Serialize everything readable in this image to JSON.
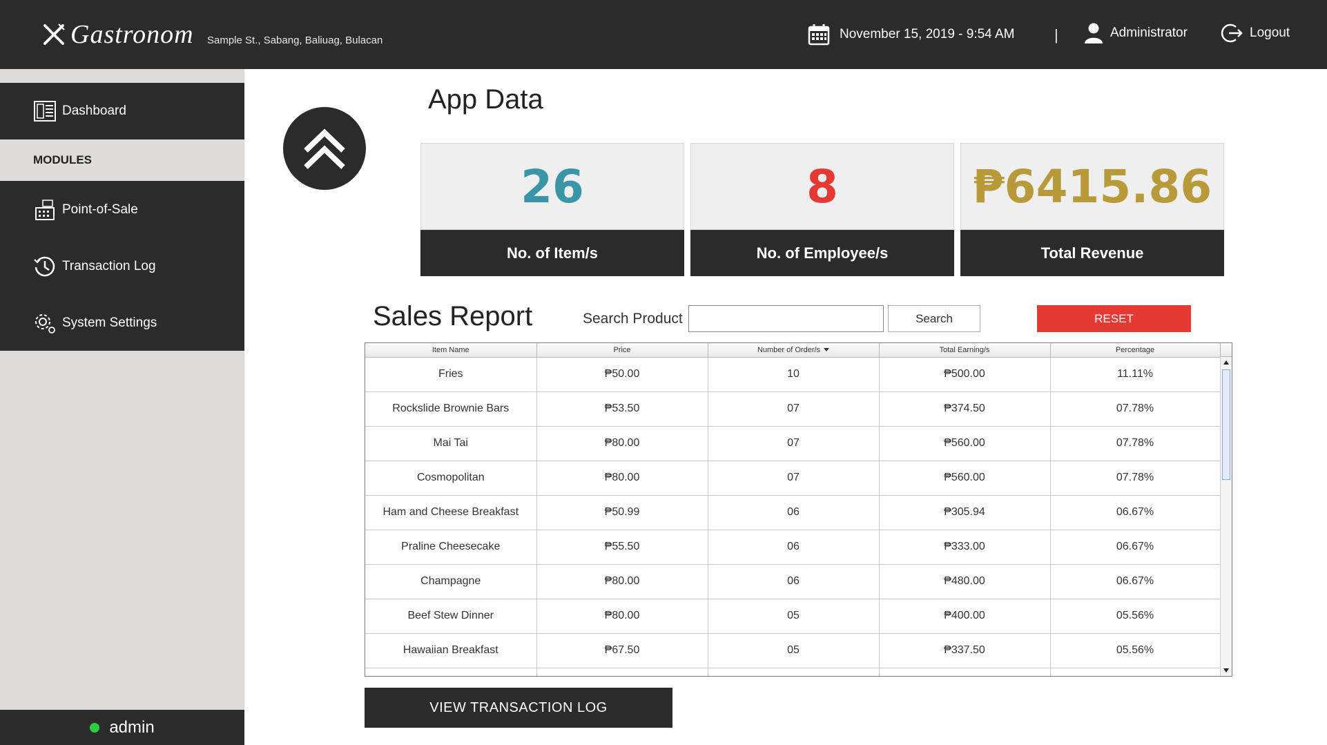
{
  "header": {
    "brand": "Gastronom",
    "address": "Sample St., Sabang, Baliuag, Bulacan",
    "datetime": "November 15, 2019 - 9:54 AM",
    "separator": "|",
    "user": "Administrator",
    "logout": "Logout"
  },
  "sidebar": {
    "dashboard": "Dashboard",
    "modules_label": "MODULES",
    "items": [
      {
        "label": "Point-of-Sale",
        "icon": "register-icon"
      },
      {
        "label": "Transaction Log",
        "icon": "clock-icon"
      },
      {
        "label": "System Settings",
        "icon": "gear-icon"
      }
    ],
    "current_user": "admin",
    "status_color": "#2ecc40"
  },
  "app_data": {
    "title": "App Data",
    "cards": [
      {
        "value": "26",
        "label": "No. of Item/s",
        "color": "#3a96a6"
      },
      {
        "value": "8",
        "label": "No. of Employee/s",
        "color": "#e53935"
      },
      {
        "value": "₱6415.86",
        "label": "Total Revenue",
        "color": "#b89a3a"
      }
    ]
  },
  "sales_report": {
    "title": "Sales Report",
    "search_label": "Search Product",
    "search_value": "",
    "search_button": "Search",
    "reset_button": "RESET",
    "columns": [
      "Item Name",
      "Price",
      "Number of Order/s",
      "Total Earning/s",
      "Percentage"
    ],
    "rows": [
      [
        "Fries",
        "₱50.00",
        "10",
        "₱500.00",
        "11.11%"
      ],
      [
        "Rockslide Brownie Bars",
        "₱53.50",
        "07",
        "₱374.50",
        "07.78%"
      ],
      [
        "Mai Tai",
        "₱80.00",
        "07",
        "₱560.00",
        "07.78%"
      ],
      [
        "Cosmopolitan",
        "₱80.00",
        "07",
        "₱560.00",
        "07.78%"
      ],
      [
        "Ham and Cheese Breakfast",
        "₱50.99",
        "06",
        "₱305.94",
        "06.67%"
      ],
      [
        "Praline Cheesecake",
        "₱55.50",
        "06",
        "₱333.00",
        "06.67%"
      ],
      [
        "Champagne",
        "₱80.00",
        "06",
        "₱480.00",
        "06.67%"
      ],
      [
        "Beef Stew Dinner",
        "₱80.00",
        "05",
        "₱400.00",
        "05.56%"
      ],
      [
        "Hawaiian Breakfast",
        "₱67.50",
        "05",
        "₱337.50",
        "05.56%"
      ]
    ]
  },
  "view_log_button": "VIEW TRANSACTION LOG",
  "colors": {
    "dark": "#2b2b2b",
    "sidebar_bg": "#dddcd8",
    "reset": "#e53935"
  }
}
